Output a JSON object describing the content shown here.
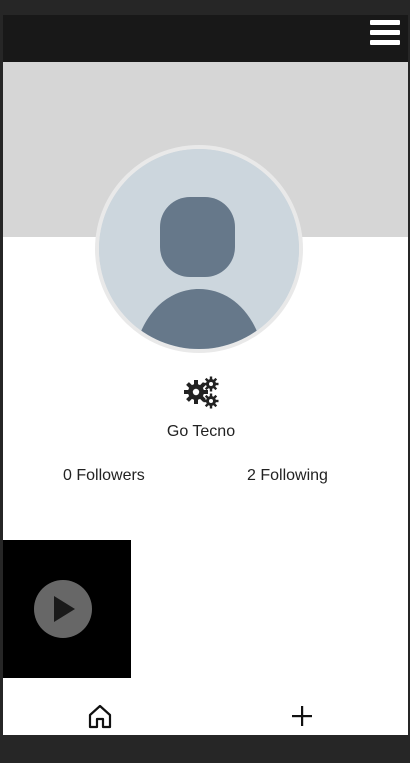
{
  "header": {
    "menu_icon": "hamburger-menu-icon",
    "background": "#181818"
  },
  "profile": {
    "cover_color": "#d6d6d6",
    "avatar_icon": "default-user-avatar",
    "settings_icon": "gears-icon",
    "username": "Go Tecno",
    "followers_label": "0 Followers",
    "following_label": "2 Following"
  },
  "videos": [
    {
      "thumbnail_color": "#000000",
      "play_icon": "play-icon"
    }
  ],
  "bottom_nav": {
    "home_icon": "home-icon",
    "add_icon": "plus-icon"
  }
}
